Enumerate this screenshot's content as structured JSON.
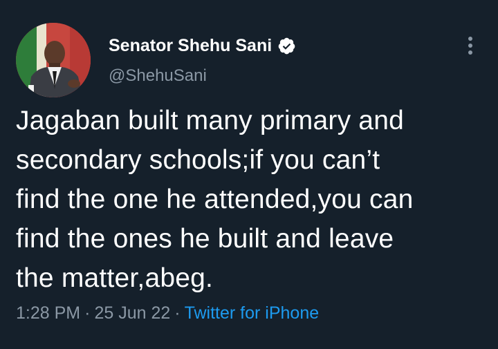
{
  "author": {
    "display_name": "Senator Shehu Sani",
    "handle": "@ShehuSani",
    "verified": true
  },
  "tweet": {
    "text_lines": [
      "Jagaban built many primary and",
      "secondary schools;if you can’t",
      "find the one he attended,you can",
      "find the ones he built and leave",
      "the matter,abeg."
    ],
    "time": "1:28 PM",
    "date": "25 Jun 22",
    "source": "Twitter for iPhone",
    "separator": "·"
  },
  "colors": {
    "background": "#15202b",
    "primary_text": "#ffffff",
    "secondary_text": "#8b98a5",
    "link": "#1d9bf0"
  },
  "icons": {
    "verified": "verified-badge-icon",
    "more": "more-options-icon"
  }
}
